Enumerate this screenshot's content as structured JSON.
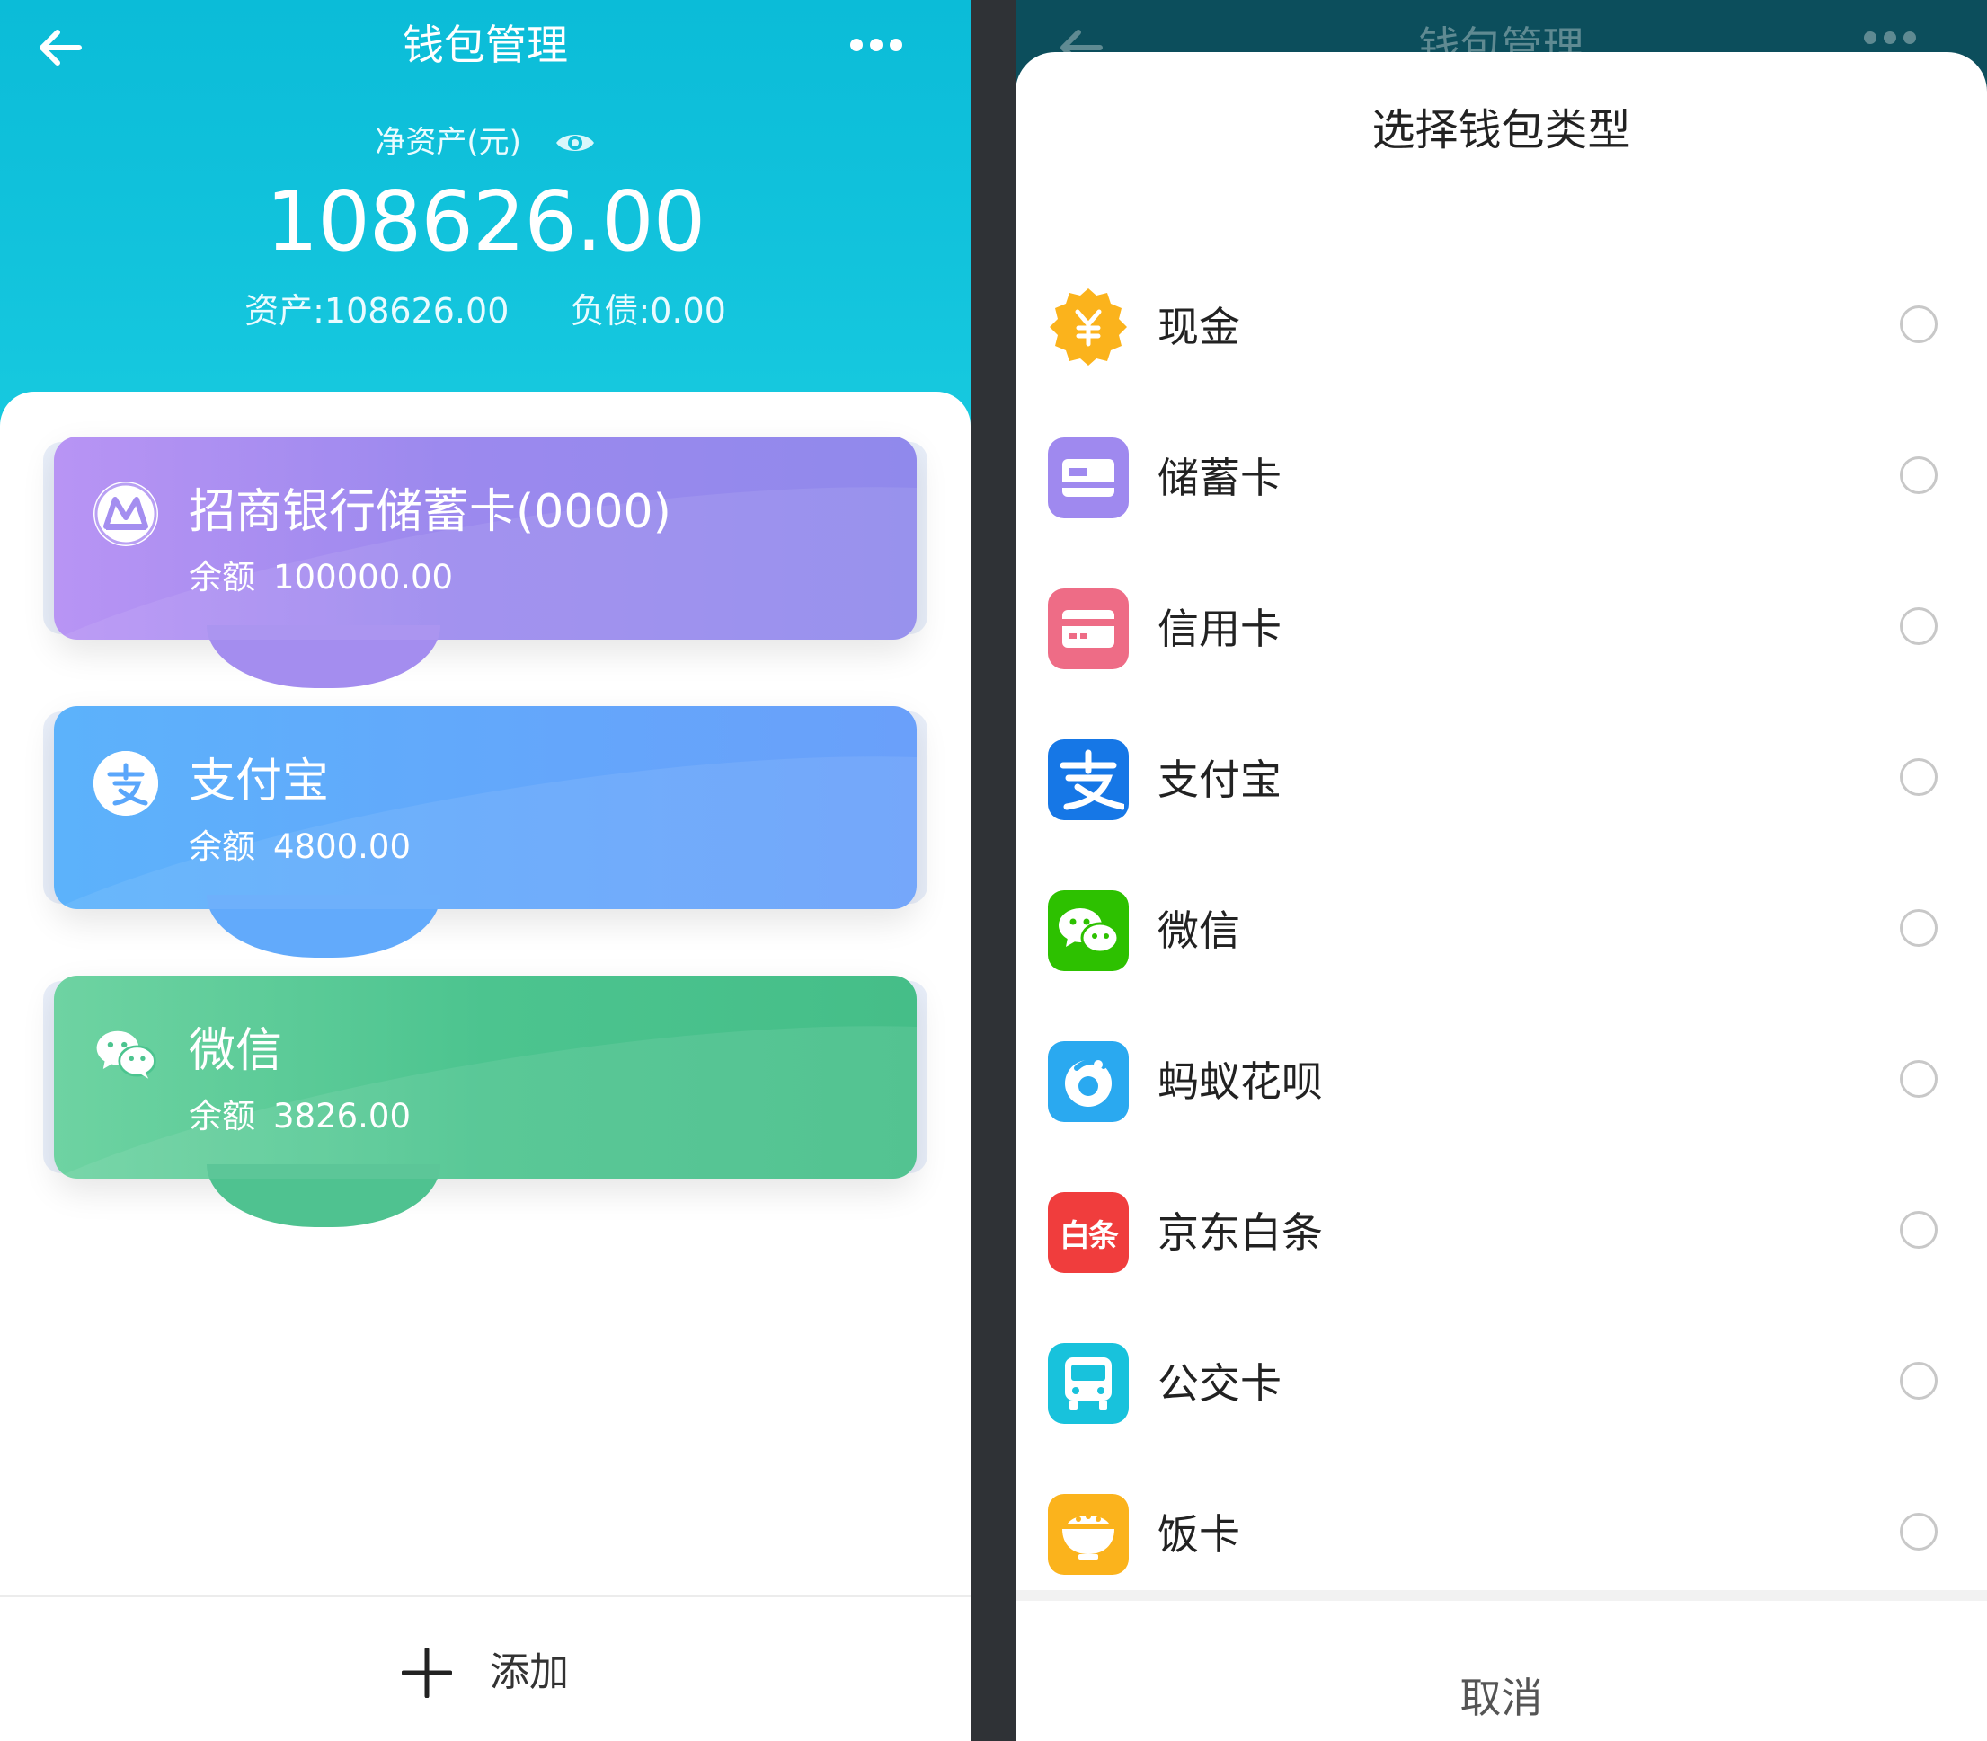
{
  "left": {
    "header": {
      "title": "钱包管理"
    },
    "net_assets": {
      "label": "净资产(元)",
      "amount": "108626.00",
      "assets": "资产:108626.00",
      "liabilities": "负债:0.00"
    },
    "wallets": [
      {
        "name": "招商银行储蓄卡(0000)",
        "balance_label": "余额",
        "balance": "100000.00",
        "icon": "cmb-bank-icon",
        "color": "#9f8aef"
      },
      {
        "name": "支付宝",
        "balance_label": "余额",
        "balance": "4800.00",
        "icon": "alipay-icon",
        "color": "#62aafb"
      },
      {
        "name": "微信",
        "balance_label": "余额",
        "balance": "3826.00",
        "icon": "wechat-icon",
        "color": "#4cc48f"
      }
    ],
    "add_label": "添加"
  },
  "right": {
    "background_title": "钱包管理",
    "sheet_title": "选择钱包类型",
    "options": [
      {
        "label": "现金",
        "icon": "cash-icon",
        "color": "#fbb31c"
      },
      {
        "label": "储蓄卡",
        "icon": "debit-card-icon",
        "color": "#9f89ef"
      },
      {
        "label": "信用卡",
        "icon": "credit-card-icon",
        "color": "#ee6c86"
      },
      {
        "label": "支付宝",
        "icon": "alipay-icon",
        "color": "#1677e6"
      },
      {
        "label": "微信",
        "icon": "wechat-icon",
        "color": "#2dc100"
      },
      {
        "label": "蚂蚁花呗",
        "icon": "huabei-icon",
        "color": "#2aa9f0"
      },
      {
        "label": "京东白条",
        "icon": "jd-baitiao-icon",
        "icon_text": "白条",
        "color": "#f03d3d"
      },
      {
        "label": "公交卡",
        "icon": "bus-card-icon",
        "color": "#18c2dc"
      },
      {
        "label": "饭卡",
        "icon": "meal-card-icon",
        "color": "#fbb31c"
      }
    ],
    "cancel_label": "取消"
  }
}
